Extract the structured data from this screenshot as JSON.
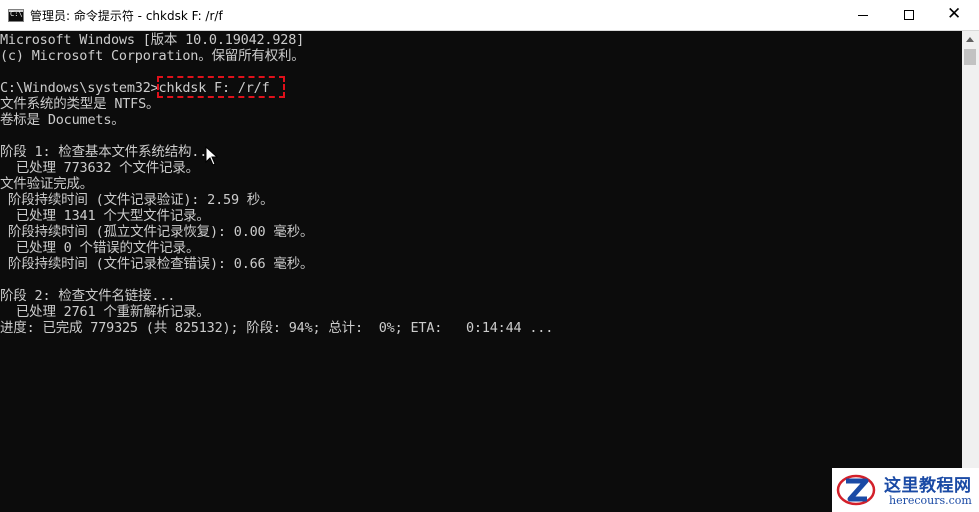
{
  "window": {
    "title": "管理员: 命令提示符 - chkdsk  F: /r/f",
    "icon_label": "C:\\",
    "controls": {
      "minimize": "minimize",
      "maximize": "maximize",
      "close": "✕"
    }
  },
  "console": {
    "lines": [
      "Microsoft Windows [版本 10.0.19042.928]",
      "(c) Microsoft Corporation。保留所有权利。",
      "",
      "C:\\Windows\\system32>chkdsk F: /r/f",
      "文件系统的类型是 NTFS。",
      "卷标是 Documets。",
      "",
      "阶段 1: 检查基本文件系统结构...",
      "  已处理 773632 个文件记录。",
      "文件验证完成。",
      " 阶段持续时间 (文件记录验证): 2.59 秒。",
      "  已处理 1341 个大型文件记录。",
      " 阶段持续时间 (孤立文件记录恢复): 0.00 毫秒。",
      "  已处理 0 个错误的文件记录。",
      " 阶段持续时间 (文件记录检查错误): 0.66 毫秒。",
      "",
      "阶段 2: 检查文件名链接...",
      "  已处理 2761 个重新解析记录。",
      "进度: 已完成 779325 (共 825132); 阶段: 94%; 总计:  0%; ETA:   0:14:44 ..."
    ],
    "highlight_color": "#e0101a"
  },
  "watermark": {
    "title": "这里教程网",
    "url": "herecours.com"
  },
  "colors": {
    "console_bg": "#0c0c0c",
    "console_text": "#cccccc",
    "titlebar_bg": "#ffffff",
    "watermark_blue": "#1a4aa5"
  },
  "icons": [
    "console-app-icon",
    "minimize-icon",
    "maximize-icon",
    "close-icon",
    "mouse-cursor-icon",
    "scroll-up-arrow-icon",
    "watermark-logo-icon"
  ]
}
